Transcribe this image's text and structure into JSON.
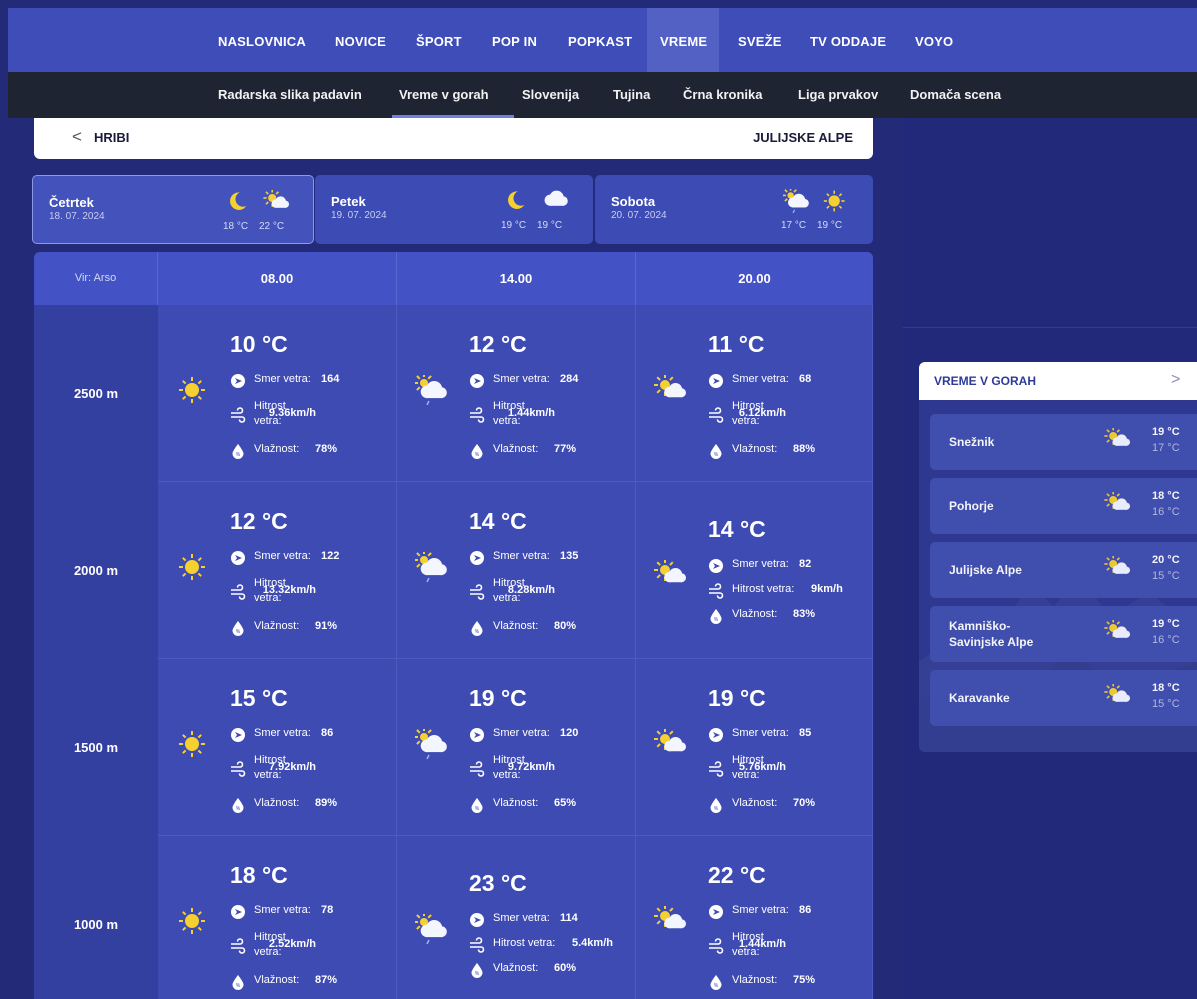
{
  "top_nav": [
    "NASLOVNICA",
    "NOVICE",
    "ŠPORT",
    "POP IN",
    "POPKAST",
    "VREME",
    "SVEŽE",
    "TV ODDAJE",
    "VOYO"
  ],
  "sub_nav": [
    "Radarska slika padavin",
    "Vreme v gorah",
    "Slovenija",
    "Tujina",
    "Črna kronika",
    "Liga prvakov",
    "Domača scena"
  ],
  "breadcrumb": {
    "back": "<",
    "left": "HRIBI",
    "right": "JULIJSKE ALPE"
  },
  "days": [
    {
      "name": "Četrtek",
      "date": "18. 07. 2024",
      "t1": "18 °C",
      "t2": "22 °C",
      "icons": [
        "moon-icon",
        "sun-cloud-icon"
      ]
    },
    {
      "name": "Petek",
      "date": "19. 07. 2024",
      "t1": "19 °C",
      "t2": "19 °C",
      "icons": [
        "moon-icon",
        "cloud-icon"
      ]
    },
    {
      "name": "Sobota",
      "date": "20. 07. 2024",
      "t1": "17 °C",
      "t2": "19 °C",
      "icons": [
        "cloud-rain-icon",
        "sun-icon"
      ]
    }
  ],
  "table": {
    "source": "Vir: Arso",
    "times": [
      "08.00",
      "14.00",
      "20.00"
    ],
    "wind_dir_label": "Smer vetra:",
    "wind_speed_label_1": "Hitrost",
    "wind_speed_label_2": "vetra:",
    "wind_speed_label_inline": "Hitrost vetra:",
    "humidity_label": "Vlažnost:",
    "rows": [
      {
        "alt": "2500 m",
        "cells": [
          {
            "temp": "10 °C",
            "dir": "164",
            "speed": "9.36km/h",
            "hum": "78%",
            "icon": "sun-icon",
            "layout": "split"
          },
          {
            "temp": "12 °C",
            "dir": "284",
            "speed": "1.44km/h",
            "hum": "77%",
            "icon": "cloud-rain-icon",
            "layout": "split"
          },
          {
            "temp": "11 °C",
            "dir": "68",
            "speed": "6.12km/h",
            "hum": "88%",
            "icon": "sun-cloud-icon",
            "layout": "split"
          }
        ]
      },
      {
        "alt": "2000 m",
        "cells": [
          {
            "temp": "12 °C",
            "dir": "122",
            "speed": "13.32km/h",
            "hum": "91%",
            "icon": "sun-icon",
            "layout": "split"
          },
          {
            "temp": "14 °C",
            "dir": "135",
            "speed": "8.28km/h",
            "hum": "80%",
            "icon": "cloud-rain-icon",
            "layout": "split"
          },
          {
            "temp": "14 °C",
            "dir": "82",
            "speed": "9km/h",
            "hum": "83%",
            "icon": "sun-cloud-icon",
            "layout": "inline"
          }
        ]
      },
      {
        "alt": "1500 m",
        "cells": [
          {
            "temp": "15 °C",
            "dir": "86",
            "speed": "7.92km/h",
            "hum": "89%",
            "icon": "sun-icon",
            "layout": "split"
          },
          {
            "temp": "19 °C",
            "dir": "120",
            "speed": "9.72km/h",
            "hum": "65%",
            "icon": "cloud-rain-icon",
            "layout": "split"
          },
          {
            "temp": "19 °C",
            "dir": "85",
            "speed": "5.76km/h",
            "hum": "70%",
            "icon": "sun-cloud-icon",
            "layout": "split"
          }
        ]
      },
      {
        "alt": "1000 m",
        "cells": [
          {
            "temp": "18 °C",
            "dir": "78",
            "speed": "2.52km/h",
            "hum": "87%",
            "icon": "sun-icon",
            "layout": "split"
          },
          {
            "temp": "23 °C",
            "dir": "114",
            "speed": "5.4km/h",
            "hum": "60%",
            "icon": "cloud-rain-icon",
            "layout": "inline"
          },
          {
            "temp": "22 °C",
            "dir": "86",
            "speed": "1.44km/h",
            "hum": "75%",
            "icon": "sun-cloud-icon",
            "layout": "split"
          }
        ]
      }
    ]
  },
  "sidebar": {
    "title": "VREME V GORAH",
    "chevron": ">",
    "items": [
      {
        "name": "Snežnik",
        "hi": "19 °C",
        "lo": "17 °C"
      },
      {
        "name": "Pohorje",
        "hi": "18 °C",
        "lo": "16 °C"
      },
      {
        "name": "Julijske Alpe",
        "hi": "20 °C",
        "lo": "15 °C"
      },
      {
        "name": "Kamniško-\nSavinjske Alpe",
        "hi": "19 °C",
        "lo": "16 °C"
      },
      {
        "name": "Karavanke",
        "hi": "18 °C",
        "lo": "15 °C"
      }
    ]
  },
  "colors": {
    "nav": "#3f4db8",
    "subnav": "#1f2432",
    "page": "#232a78",
    "table": "#3e4bb2",
    "sun": "#f6d02f"
  }
}
